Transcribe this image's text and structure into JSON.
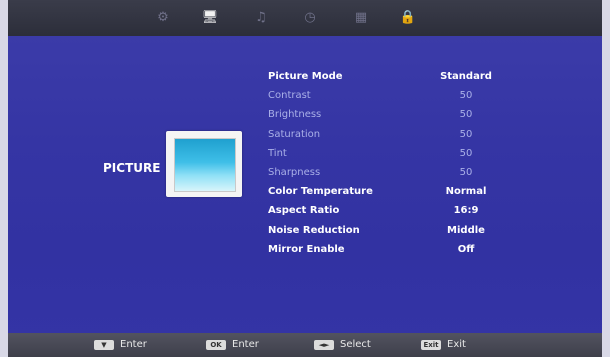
{
  "top_tabs": [
    {
      "icon": "gear-icon",
      "glyph": "⚙",
      "active": false
    },
    {
      "icon": "monitor-icon",
      "glyph": "🖥",
      "active": true
    },
    {
      "icon": "music-note-icon",
      "glyph": "♫",
      "active": false
    },
    {
      "icon": "clock-icon",
      "glyph": "◷",
      "active": false
    },
    {
      "icon": "grid-icon",
      "glyph": "▦",
      "active": false
    },
    {
      "icon": "lock-icon",
      "glyph": "🔒",
      "active": false
    }
  ],
  "section": {
    "title": "PICTURE"
  },
  "menu": [
    {
      "label": "Picture Mode",
      "value": "Standard",
      "enabled": true
    },
    {
      "label": "Contrast",
      "value": "50",
      "enabled": false
    },
    {
      "label": "Brightness",
      "value": "50",
      "enabled": false
    },
    {
      "label": "Saturation",
      "value": "50",
      "enabled": false
    },
    {
      "label": "Tint",
      "value": "50",
      "enabled": false
    },
    {
      "label": "Sharpness",
      "value": "50",
      "enabled": false
    },
    {
      "label": "Color Temperature",
      "value": "Normal",
      "enabled": true
    },
    {
      "label": "Aspect Ratio",
      "value": "16:9",
      "enabled": true
    },
    {
      "label": "Noise Reduction",
      "value": "Middle",
      "enabled": true
    },
    {
      "label": "Mirror Enable",
      "value": "Off",
      "enabled": true
    }
  ],
  "hints": [
    {
      "key": "▼",
      "label": "Enter"
    },
    {
      "key": "OK",
      "label": "Enter"
    },
    {
      "key": "◄►",
      "label": "Select"
    },
    {
      "key": "Exit",
      "label": "Exit"
    }
  ],
  "colors": {
    "background": "#3535a4",
    "enabled_text": "#ffffff",
    "disabled_text": "#aab0e8"
  }
}
